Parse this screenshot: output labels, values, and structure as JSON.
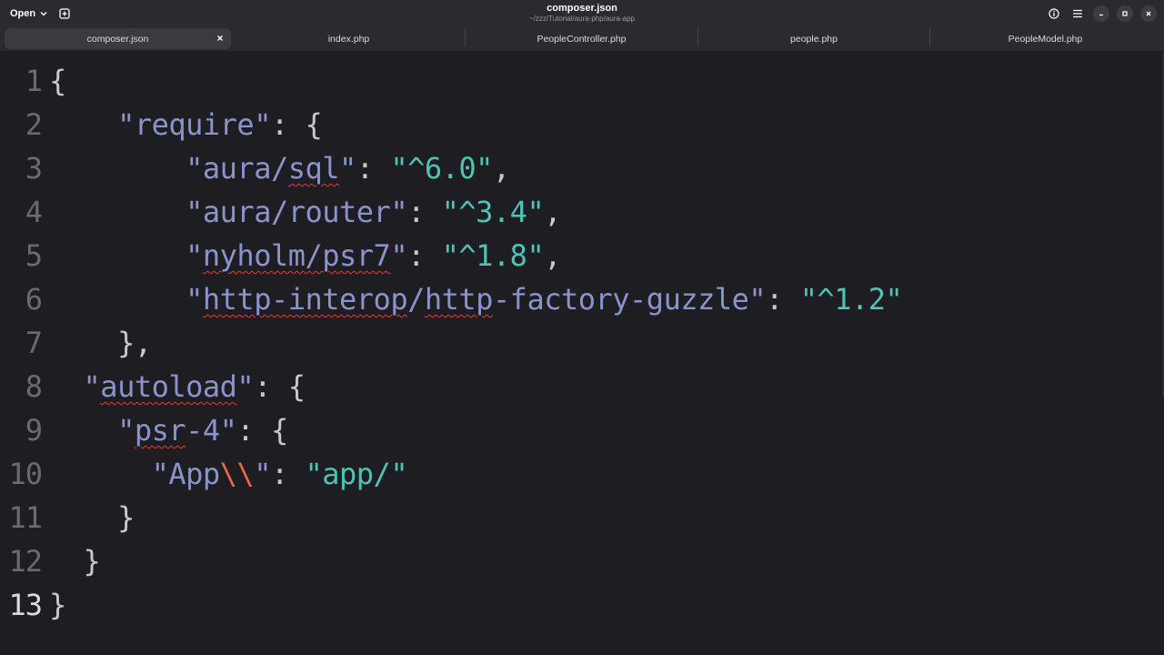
{
  "header": {
    "open_label": "Open",
    "title": "composer.json",
    "subtitle": "~/zzz/Tutorial/aura-php/aura-app"
  },
  "tabs": [
    {
      "label": "composer.json",
      "active": true
    },
    {
      "label": "index.php",
      "active": false
    },
    {
      "label": "PeopleController.php",
      "active": false
    },
    {
      "label": "people.php",
      "active": false
    },
    {
      "label": "PeopleModel.php",
      "active": false
    }
  ],
  "editor": {
    "current_line": 13,
    "lines": [
      {
        "n": "1",
        "indent": "",
        "segs": [
          {
            "t": "{",
            "c": "p"
          }
        ]
      },
      {
        "n": "2",
        "indent": "    ",
        "segs": [
          {
            "t": "\"require\"",
            "c": "k"
          },
          {
            "t": ": {",
            "c": "p"
          }
        ]
      },
      {
        "n": "3",
        "indent": "        ",
        "segs": [
          {
            "t": "\"aura/",
            "c": "k"
          },
          {
            "t": "sql",
            "c": "k",
            "sq": true
          },
          {
            "t": "\"",
            "c": "k"
          },
          {
            "t": ": ",
            "c": "p"
          },
          {
            "t": "\"^6.0\"",
            "c": "s"
          },
          {
            "t": ",",
            "c": "p"
          }
        ]
      },
      {
        "n": "4",
        "indent": "        ",
        "segs": [
          {
            "t": "\"aura/router\"",
            "c": "k"
          },
          {
            "t": ": ",
            "c": "p"
          },
          {
            "t": "\"^3.4\"",
            "c": "s"
          },
          {
            "t": ",",
            "c": "p"
          }
        ]
      },
      {
        "n": "5",
        "indent": "        ",
        "segs": [
          {
            "t": "\"",
            "c": "k"
          },
          {
            "t": "nyholm/psr7",
            "c": "k",
            "sq": true
          },
          {
            "t": "\"",
            "c": "k"
          },
          {
            "t": ": ",
            "c": "p"
          },
          {
            "t": "\"^1.8\"",
            "c": "s"
          },
          {
            "t": ",",
            "c": "p"
          }
        ]
      },
      {
        "n": "6",
        "indent": "        ",
        "segs": [
          {
            "t": "\"",
            "c": "k"
          },
          {
            "t": "http-interop",
            "c": "k",
            "sq": true
          },
          {
            "t": "/",
            "c": "k"
          },
          {
            "t": "http",
            "c": "k",
            "sq": true
          },
          {
            "t": "-factory-guzzle\"",
            "c": "k"
          },
          {
            "t": ": ",
            "c": "p"
          },
          {
            "t": "\"^1.2\"",
            "c": "s"
          }
        ]
      },
      {
        "n": "7",
        "indent": "    ",
        "segs": [
          {
            "t": "},",
            "c": "p"
          }
        ]
      },
      {
        "n": "8",
        "indent": "  ",
        "segs": [
          {
            "t": "\"",
            "c": "k"
          },
          {
            "t": "autoload",
            "c": "k",
            "sq": true
          },
          {
            "t": "\"",
            "c": "k"
          },
          {
            "t": ": {",
            "c": "p"
          }
        ]
      },
      {
        "n": "9",
        "indent": "    ",
        "segs": [
          {
            "t": "\"",
            "c": "k"
          },
          {
            "t": "psr",
            "c": "k",
            "sq": true
          },
          {
            "t": "-4\"",
            "c": "k"
          },
          {
            "t": ": {",
            "c": "p"
          }
        ]
      },
      {
        "n": "10",
        "indent": "      ",
        "segs": [
          {
            "t": "\"App",
            "c": "k"
          },
          {
            "t": "\\\\",
            "c": "e"
          },
          {
            "t": "\"",
            "c": "k"
          },
          {
            "t": ": ",
            "c": "p"
          },
          {
            "t": "\"app/\"",
            "c": "s"
          }
        ]
      },
      {
        "n": "11",
        "indent": "    ",
        "segs": [
          {
            "t": "}",
            "c": "p"
          }
        ]
      },
      {
        "n": "12",
        "indent": "  ",
        "segs": [
          {
            "t": "}",
            "c": "p"
          }
        ]
      },
      {
        "n": "13",
        "indent": "",
        "segs": [
          {
            "t": "}",
            "c": "p"
          }
        ]
      }
    ]
  },
  "colors": {
    "key": "#8b93cc",
    "string": "#4ec3b6",
    "escape": "#e8684a",
    "punct": "#c8c8c8",
    "background": "#1e1e22",
    "spell_error": "#d9403a"
  },
  "icons": {
    "open_dropdown": "chevron-down-icon",
    "new_tab": "new-tab-icon",
    "info": "info-icon",
    "menu": "hamburger-menu-icon",
    "minimize": "minimize-icon",
    "maximize": "maximize-icon",
    "close": "close-icon",
    "tab_close": "tab-close-icon"
  }
}
